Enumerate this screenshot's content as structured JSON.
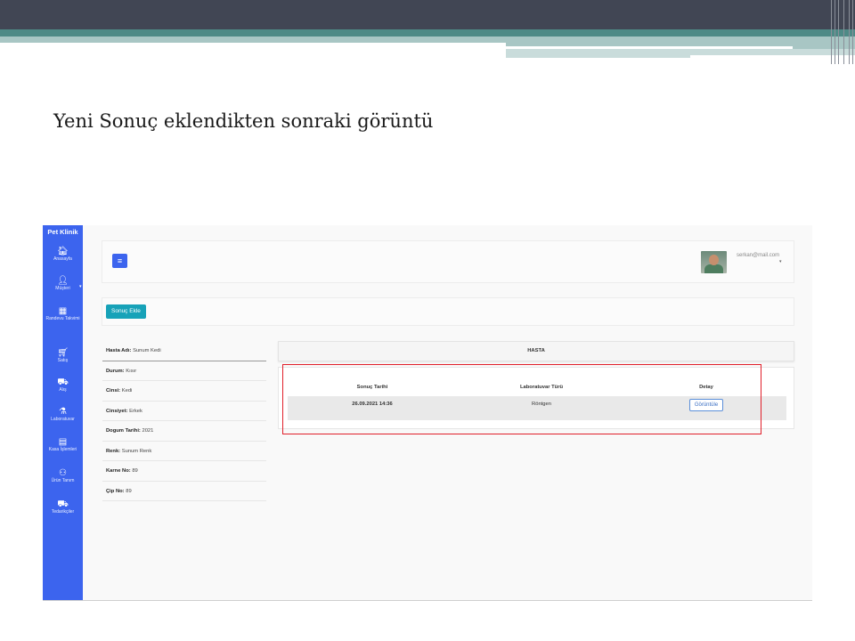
{
  "slide": {
    "title": "Yeni Sonuç eklendikten sonraki görüntü"
  },
  "app": {
    "brand": "Pet Klinik",
    "accent_color": "#3c64ee",
    "sidebar": {
      "items": [
        {
          "icon": "home-icon",
          "glyph": "🏠︎",
          "label": "Anasayfa"
        },
        {
          "icon": "user-icon",
          "glyph": "👤︎",
          "label": "Müşteri"
        },
        {
          "icon": "calendar-icon",
          "glyph": "▦",
          "label": "Randevu Takvimi"
        },
        {
          "icon": "basket-icon",
          "glyph": "🛒︎",
          "label": "Satış"
        },
        {
          "icon": "truck-icon",
          "glyph": "⛟",
          "label": "Alış"
        },
        {
          "icon": "flask-icon",
          "glyph": "⚗",
          "label": "Laboratuvar"
        },
        {
          "icon": "cash-icon",
          "glyph": "▤",
          "label": "Kasa İşlemleri"
        },
        {
          "icon": "people-carry-icon",
          "glyph": "⚇",
          "label": "Ürün Tanım"
        },
        {
          "icon": "truck-icon",
          "glyph": "⛟",
          "label": "Tedarikçiler"
        }
      ]
    },
    "header": {
      "menu_glyph": "≡",
      "user_email": "serkan@mail.com",
      "caret": "▾"
    },
    "actions": {
      "add_result_label": "Sonuç Ekle"
    },
    "patient": {
      "rows": [
        {
          "label": "Hasta Adı:",
          "value": "Sunum Kedi"
        },
        {
          "label": "Durum:",
          "value": "Kısır"
        },
        {
          "label": "Cinsi:",
          "value": "Kedi"
        },
        {
          "label": "Cinsiyet:",
          "value": "Erkek"
        },
        {
          "label": "Dogum Tarihi:",
          "value": "2021"
        },
        {
          "label": "Renk:",
          "value": "Sunum Renk"
        },
        {
          "label": "Karne No:",
          "value": "89"
        },
        {
          "label": "Çip No:",
          "value": "89"
        }
      ]
    },
    "results": {
      "section_title": "HASTA",
      "columns": [
        "Sonuç Tarihi",
        "Laboratuvar Türü",
        "Detay"
      ],
      "rows": [
        {
          "date": "26.09.2021 14:36",
          "type": "Röntgen",
          "action": "Görüntüle"
        }
      ],
      "highlight_color": "#e11f2a"
    }
  }
}
